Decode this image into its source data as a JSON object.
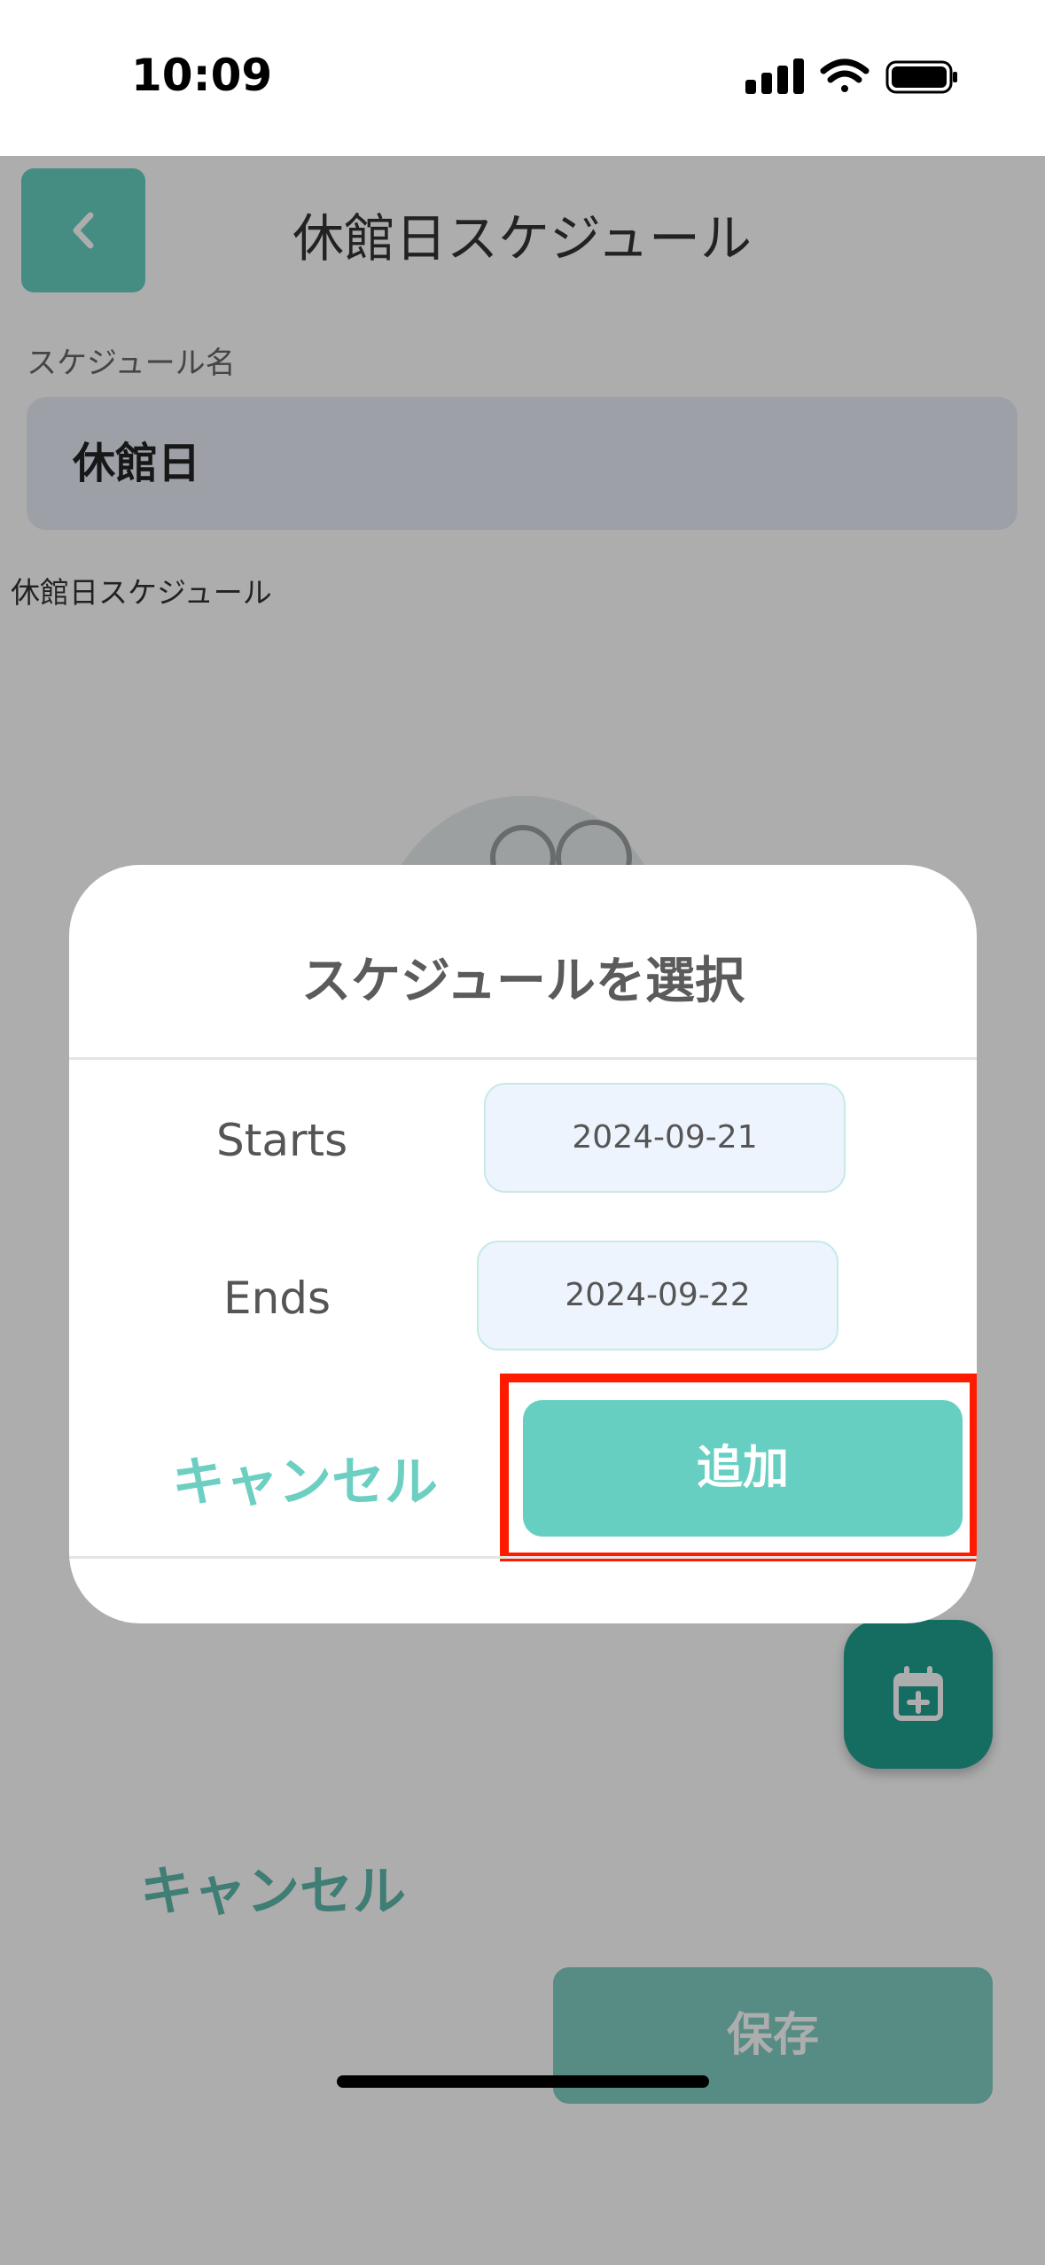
{
  "status_bar": {
    "time": "10:09"
  },
  "header": {
    "title": "休館日スケジュール"
  },
  "form": {
    "name_label": "スケジュール名",
    "name_value": "休館日",
    "section_label": "休館日スケジュール"
  },
  "bottom_actions": {
    "cancel_label": "キャンセル",
    "save_label": "保存"
  },
  "modal": {
    "title": "スケジュールを選択",
    "starts_label": "Starts",
    "starts_value": "2024-09-21",
    "ends_label": "Ends",
    "ends_value": "2024-09-22",
    "cancel_label": "キャンセル",
    "add_label": "追加"
  },
  "colors": {
    "accent": "#66cfc2",
    "fab": "#1fa191",
    "highlight": "#ff1b00"
  }
}
